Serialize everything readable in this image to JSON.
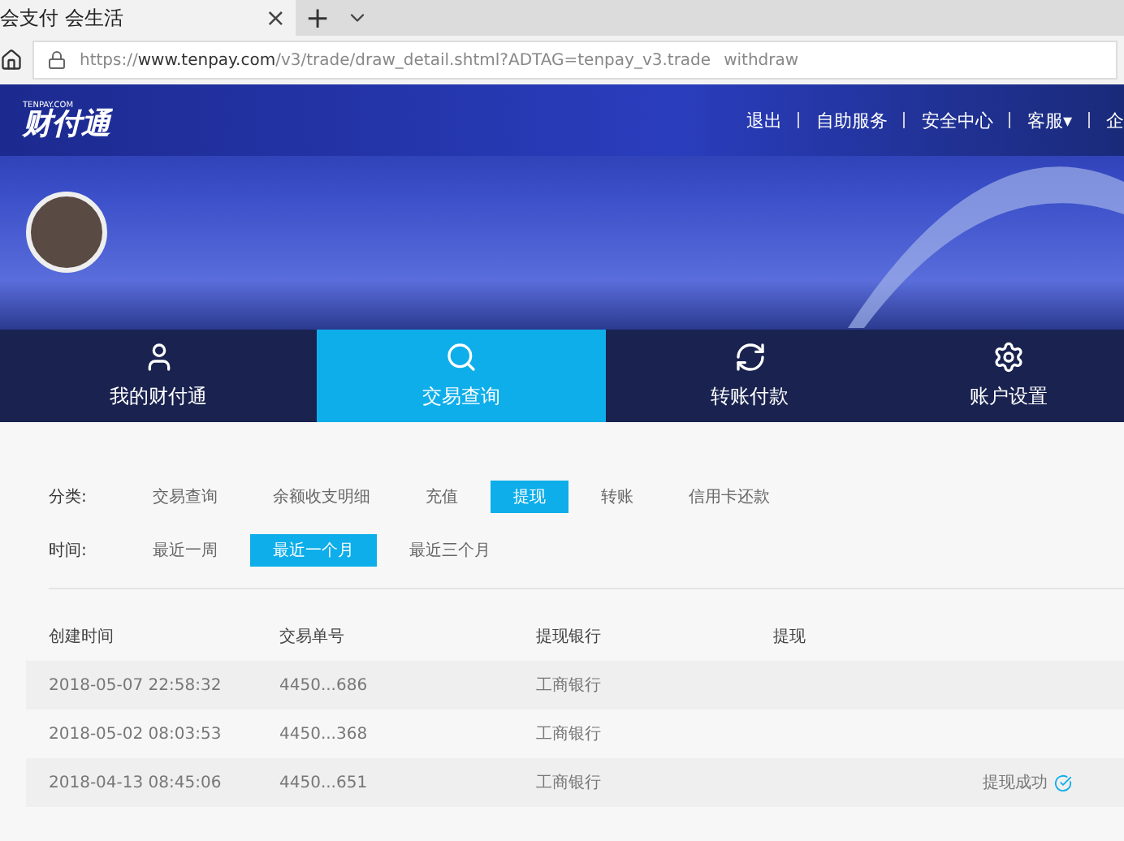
{
  "browser": {
    "tab_title": "会支付 会生活",
    "tab_close": "×",
    "new_tab": "+",
    "url_host_prefix": "https://",
    "url_host": "www.tenpay.com",
    "url_path": "/v3/trade/draw_detail.shtml?ADTAG=tenpay_v3.trade",
    "url_tail": "withdraw"
  },
  "header": {
    "logo": "财付通",
    "logo_small": "TENPAY.COM",
    "links": [
      "退出",
      "自助服务",
      "安全中心",
      "客服▾",
      "企"
    ]
  },
  "nav": [
    {
      "label": "我的财付通",
      "selected": false
    },
    {
      "label": "交易查询",
      "selected": true
    },
    {
      "label": "转账付款",
      "selected": false
    },
    {
      "label": "账户设置",
      "selected": false
    }
  ],
  "filters": [
    {
      "label": "分类:",
      "options": [
        {
          "label": "交易查询",
          "selected": false
        },
        {
          "label": "余额收支明细",
          "selected": false
        },
        {
          "label": "充值",
          "selected": false
        },
        {
          "label": "提现",
          "selected": true
        },
        {
          "label": "转账",
          "selected": false
        },
        {
          "label": "信用卡还款",
          "selected": false
        }
      ]
    },
    {
      "label": "时间:",
      "options": [
        {
          "label": "最近一周",
          "selected": false
        },
        {
          "label": "最近一个月",
          "selected": true
        },
        {
          "label": "最近三个月",
          "selected": false
        }
      ]
    }
  ],
  "table": {
    "columns": [
      "创建时间",
      "交易单号",
      "提现银行",
      "提现"
    ],
    "rows": [
      {
        "cells": [
          "2018-05-07 22:58:32",
          "4450...686",
          "工商银行"
        ]
      },
      {
        "cells": [
          "2018-05-02 08:03:53",
          "4450...368",
          "工商银行"
        ]
      },
      {
        "cells": [
          "2018-04-13 08:45:06",
          "4450...651",
          "工商银行"
        ],
        "status": "提现成功"
      }
    ]
  }
}
